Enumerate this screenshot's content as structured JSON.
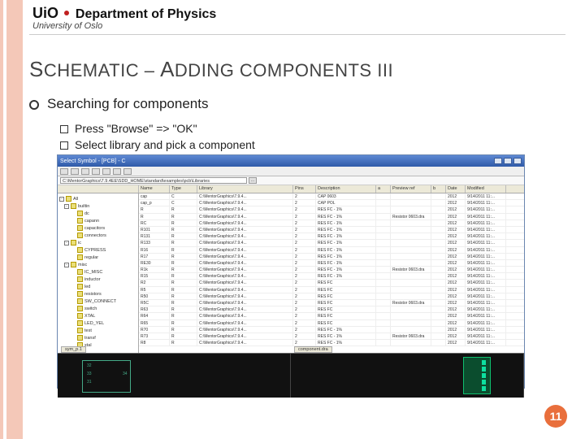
{
  "header": {
    "uio": "UiO",
    "department": "Department of Physics",
    "university": "University of Oslo"
  },
  "title": {
    "s_big": "S",
    "s_rest": "CHEMATIC",
    "dash": " – ",
    "a_big": "A",
    "a_rest": "DDING COMPONENTS",
    "roman": " III"
  },
  "bullets": {
    "main": "Searching for components",
    "sub1": "Press \"Browse\" => \"OK\"",
    "sub2": "Select library and pick a component"
  },
  "page_number": "11",
  "app": {
    "window_title": "Select Symbol - [PCB] - C",
    "min": "_",
    "max": "□",
    "close": "×",
    "path": "C:\\MentorGraphics\\7.9.4EE\\SDD_HOME\\standard\\examples\\pcb\\Libraries",
    "browse_btn": "...",
    "columns": [
      "Name",
      "Type",
      "Library",
      "Pins",
      "Description",
      "a",
      "Preview ref",
      "b",
      "Date",
      "Modified"
    ],
    "tree": [
      {
        "t": "-",
        "lbl": "All",
        "ind": 0
      },
      {
        "t": "-",
        "lbl": "builtin",
        "ind": 1
      },
      {
        "t": "",
        "lbl": "dc",
        "ind": 2
      },
      {
        "t": "",
        "lbl": "capann",
        "ind": 2
      },
      {
        "t": "",
        "lbl": "capacitors",
        "ind": 2
      },
      {
        "t": "",
        "lbl": "connectors",
        "ind": 2
      },
      {
        "t": "-",
        "lbl": "ic",
        "ind": 1
      },
      {
        "t": "",
        "lbl": "CYPRESS",
        "ind": 2
      },
      {
        "t": "",
        "lbl": "regular",
        "ind": 2
      },
      {
        "t": "-",
        "lbl": "misc",
        "ind": 1
      },
      {
        "t": "",
        "lbl": "IC_MISC",
        "ind": 2
      },
      {
        "t": "",
        "lbl": "inductor",
        "ind": 2
      },
      {
        "t": "",
        "lbl": "led",
        "ind": 2
      },
      {
        "t": "",
        "lbl": "resistors",
        "ind": 2
      },
      {
        "t": "",
        "lbl": "SW_CONNECT",
        "ind": 2
      },
      {
        "t": "",
        "lbl": "switch",
        "ind": 2
      },
      {
        "t": "",
        "lbl": "XTAL",
        "ind": 2
      },
      {
        "t": "",
        "lbl": "LED_YEL",
        "ind": 2
      },
      {
        "t": "",
        "lbl": "test",
        "ind": 2
      },
      {
        "t": "",
        "lbl": "transf",
        "ind": 2
      },
      {
        "t": "",
        "lbl": "xtal",
        "ind": 2
      }
    ],
    "rows": [
      [
        "cap",
        "C",
        "C:\\MentorGraphics\\7.9.4...",
        "2",
        "CAP 0603",
        "",
        "",
        "",
        "2012",
        "9/14/2011 11:..."
      ],
      [
        "cap_p",
        "C",
        "C:\\MentorGraphics\\7.9.4...",
        "2",
        "CAP POL",
        "",
        "",
        "",
        "2012",
        "9/14/2011 11:..."
      ],
      [
        "R",
        "R",
        "C:\\MentorGraphics\\7.9.4...",
        "2",
        "RES FC - 1%",
        "",
        "",
        "",
        "2012",
        "9/14/2011 11:..."
      ],
      [
        "R",
        "R",
        "C:\\MentorGraphics\\7.9.4...",
        "2",
        "RES FC - 1%",
        "",
        "Resistor 0603.dra",
        "",
        "2012",
        "9/14/2011 11:..."
      ],
      [
        "RC",
        "R",
        "C:\\MentorGraphics\\7.9.4...",
        "2",
        "RES FC - 1%",
        "",
        "",
        "",
        "2012",
        "9/14/2011 11:..."
      ],
      [
        "R101",
        "R",
        "C:\\MentorGraphics\\7.9.4...",
        "2",
        "RES FC - 1%",
        "",
        "",
        "",
        "2012",
        "9/14/2011 11:..."
      ],
      [
        "R131",
        "R",
        "C:\\MentorGraphics\\7.9.4...",
        "2",
        "RES FC - 1%",
        "",
        "",
        "",
        "2012",
        "9/14/2011 11:..."
      ],
      [
        "R133",
        "R",
        "C:\\MentorGraphics\\7.9.4...",
        "2",
        "RES FC - 1%",
        "",
        "",
        "",
        "2012",
        "9/14/2011 11:..."
      ],
      [
        "R16",
        "R",
        "C:\\MentorGraphics\\7.9.4...",
        "2",
        "RES FC - 1%",
        "",
        "",
        "",
        "2012",
        "9/14/2011 11:..."
      ],
      [
        "R17",
        "R",
        "C:\\MentorGraphics\\7.9.4...",
        "2",
        "RES FC - 1%",
        "",
        "",
        "",
        "2012",
        "9/14/2011 11:..."
      ],
      [
        "RE30",
        "R",
        "C:\\MentorGraphics\\7.9.4...",
        "2",
        "RES FC - 1%",
        "",
        "",
        "",
        "2012",
        "9/14/2011 11:..."
      ],
      [
        "R1k",
        "R",
        "C:\\MentorGraphics\\7.9.4...",
        "2",
        "RES FC - 1%",
        "",
        "Resistor 0603.dra",
        "",
        "2012",
        "9/14/2011 11:..."
      ],
      [
        "R15",
        "R",
        "C:\\MentorGraphics\\7.9.4...",
        "2",
        "RES FC - 1%",
        "",
        "",
        "",
        "2012",
        "9/14/2011 11:..."
      ],
      [
        "R2",
        "R",
        "C:\\MentorGraphics\\7.9.4...",
        "2",
        "RES FC",
        "",
        "",
        "",
        "2012",
        "9/14/2011 11:..."
      ],
      [
        "R5",
        "R",
        "C:\\MentorGraphics\\7.9.4...",
        "2",
        "RES FC",
        "",
        "",
        "",
        "2012",
        "9/14/2011 11:..."
      ],
      [
        "R50",
        "R",
        "C:\\MentorGraphics\\7.9.4...",
        "2",
        "RES FC",
        "",
        "",
        "",
        "2012",
        "9/14/2011 11:..."
      ],
      [
        "R5C",
        "R",
        "C:\\MentorGraphics\\7.9.4...",
        "2",
        "RES FC",
        "",
        "Resistor 0603.dra",
        "",
        "2012",
        "9/14/2011 11:..."
      ],
      [
        "R63",
        "R",
        "C:\\MentorGraphics\\7.9.4...",
        "2",
        "RES FC",
        "",
        "",
        "",
        "2012",
        "9/14/2011 11:..."
      ],
      [
        "R64",
        "R",
        "C:\\MentorGraphics\\7.9.4...",
        "2",
        "RES FC",
        "",
        "",
        "",
        "2012",
        "9/14/2011 11:..."
      ],
      [
        "R65",
        "R",
        "C:\\MentorGraphics\\7.9.4...",
        "2",
        "RES FC",
        "",
        "",
        "",
        "2012",
        "9/14/2011 11:..."
      ],
      [
        "R70",
        "R",
        "C:\\MentorGraphics\\7.9.4...",
        "2",
        "RES FC - 1%",
        "",
        "",
        "",
        "2012",
        "9/14/2011 11:..."
      ],
      [
        "R73",
        "R",
        "C:\\MentorGraphics\\7.9.4...",
        "2",
        "RES FC - 1%",
        "",
        "Resistor 0603.dra",
        "",
        "2012",
        "9/14/2011 11:..."
      ],
      [
        "R8",
        "R",
        "C:\\MentorGraphics\\7.9.4...",
        "2",
        "RES FC - 1%",
        "",
        "",
        "",
        "2012",
        "9/14/2011 11:..."
      ]
    ],
    "preview_left_label": "sym_p.1",
    "preview_right_label": "component.dra"
  }
}
